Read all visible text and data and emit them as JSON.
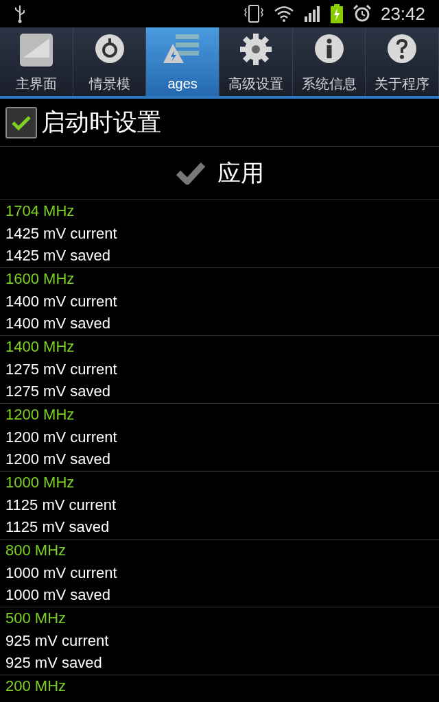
{
  "status_bar": {
    "time": "23:42"
  },
  "tabs": [
    {
      "label": "主界面",
      "kind": "chart",
      "selected": false
    },
    {
      "label": "情景模",
      "kind": "knob",
      "selected": false
    },
    {
      "label": "ages",
      "kind": "list",
      "selected": true
    },
    {
      "label": "高级设置",
      "kind": "gear",
      "selected": false
    },
    {
      "label": "系统信息",
      "kind": "info",
      "selected": false
    },
    {
      "label": "关于程序",
      "kind": "help",
      "selected": false
    }
  ],
  "startup_setting": {
    "label": "启动时设置",
    "checked": true
  },
  "apply_button": {
    "label": "应用"
  },
  "voltages": [
    {
      "frequency": "1704 MHz",
      "current": "1425 mV current",
      "saved": "1425 mV saved"
    },
    {
      "frequency": "1600 MHz",
      "current": "1400 mV current",
      "saved": "1400 mV saved"
    },
    {
      "frequency": "1400 MHz",
      "current": "1275 mV current",
      "saved": "1275 mV saved"
    },
    {
      "frequency": "1200 MHz",
      "current": "1200 mV current",
      "saved": "1200 mV saved"
    },
    {
      "frequency": "1000 MHz",
      "current": "1125 mV current",
      "saved": "1125 mV saved"
    },
    {
      "frequency": "800 MHz",
      "current": "1000 mV current",
      "saved": "1000 mV saved"
    },
    {
      "frequency": "500 MHz",
      "current": "925 mV current",
      "saved": "925 mV saved"
    },
    {
      "frequency": "200 MHz"
    }
  ]
}
